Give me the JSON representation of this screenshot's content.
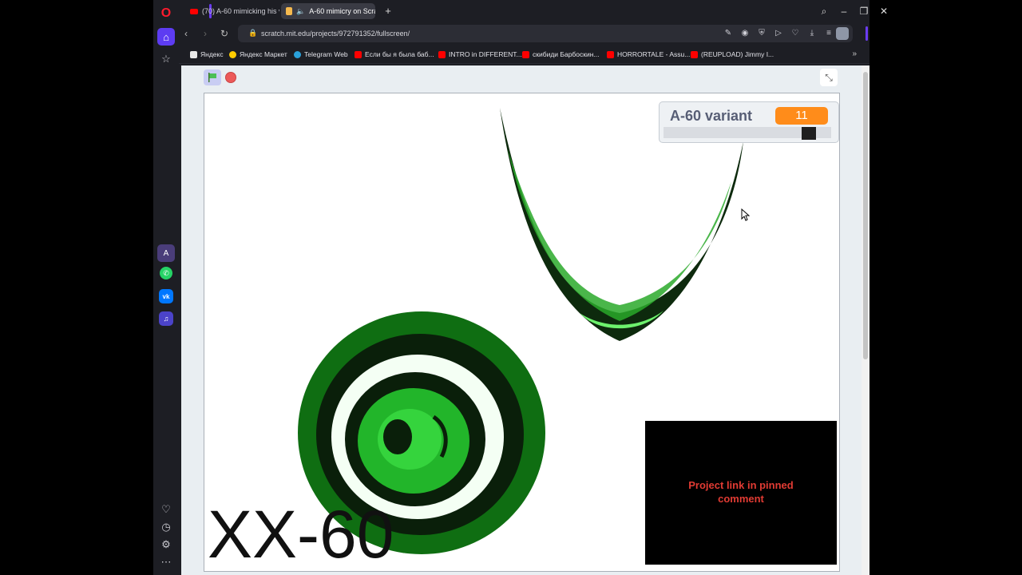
{
  "tabs": [
    {
      "title": "(70) A-60 mimicking his v"
    },
    {
      "title": "A-60 mimicry on Scrat"
    }
  ],
  "address": {
    "url": "scratch.mit.edu/projects/972791352/fullscreen/"
  },
  "bookmarks": [
    {
      "label": "Яндекс",
      "color": "#e8e8e8"
    },
    {
      "label": "Яндекс Маркет",
      "color": "#ffcc00"
    },
    {
      "label": "Telegram Web",
      "color": "#2aa1da"
    },
    {
      "label": "Если бы я была баб...",
      "color": "#ff0000"
    },
    {
      "label": "INTRO in DIFFERENT...",
      "color": "#ff0000"
    },
    {
      "label": "скибиди Барбоскин...",
      "color": "#ff0000"
    },
    {
      "label": "HORRORTALE - Assu...",
      "color": "#ff0000"
    },
    {
      "label": "(REUPLOAD) Jimmy I...",
      "color": "#ff0000"
    }
  ],
  "monitor": {
    "label": "A-60 variant",
    "value": "11",
    "slider_fraction": 0.9
  },
  "stage_text": "XX-60",
  "info_box": {
    "text": "Project link in pinned comment"
  },
  "icons": {
    "opera": "opera-logo-icon",
    "home": "home-icon",
    "star": "star-icon",
    "heart": "heart-icon",
    "history": "clock-icon",
    "settings": "gear-icon",
    "more": "more-icon"
  },
  "colors": {
    "accent": "#5d3cf2",
    "monitor_value": "#ff8c1a",
    "stop": "#ec5959",
    "info_text": "#e13b33"
  }
}
